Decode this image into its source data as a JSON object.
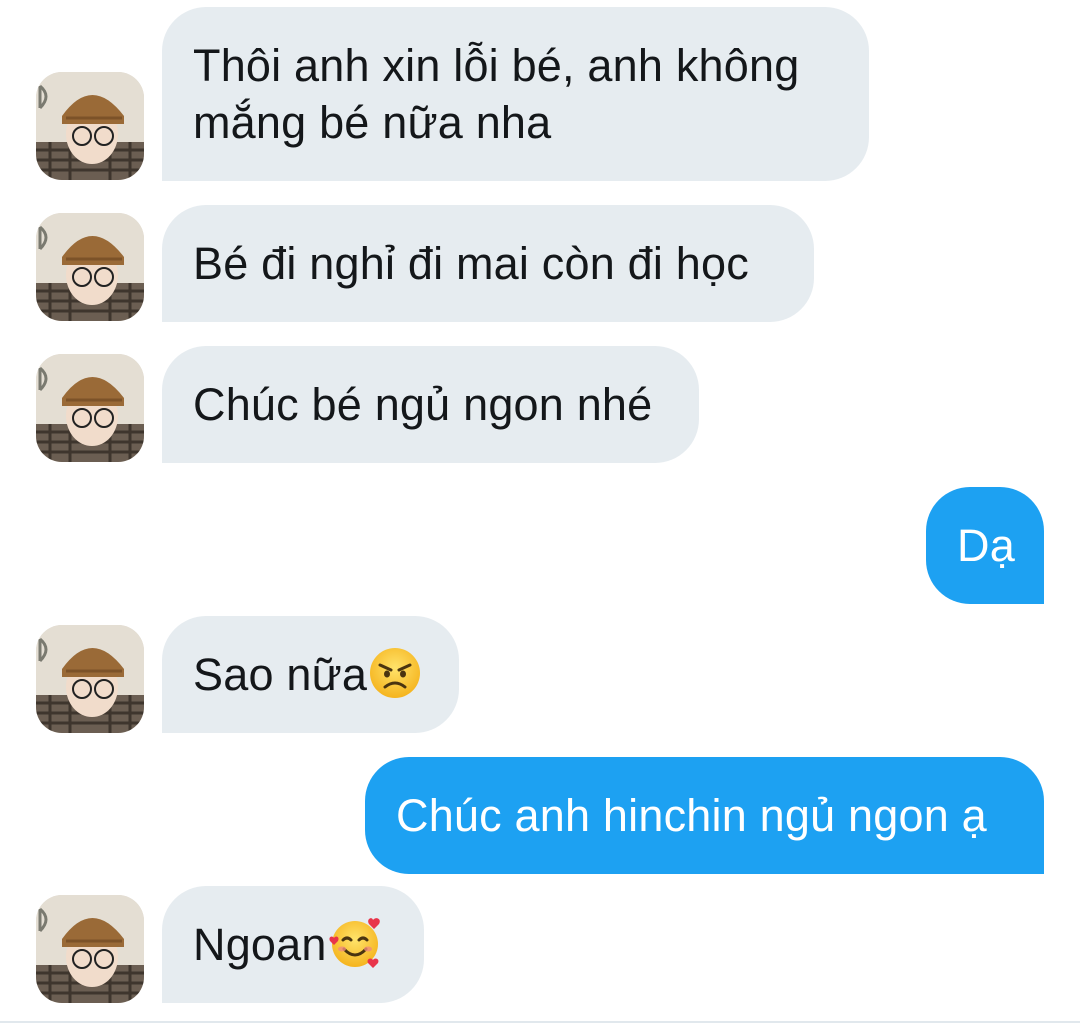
{
  "messages": [
    {
      "side": "in",
      "text": "Thôi anh xin lỗi bé, anh không\nmắng bé nữa nha"
    },
    {
      "side": "in",
      "text": "Bé đi nghỉ đi mai còn đi học"
    },
    {
      "side": "in",
      "text": "Chúc bé ngủ ngon nhé"
    },
    {
      "side": "out",
      "text": "Dạ"
    },
    {
      "side": "in",
      "text": "Sao nữa",
      "emoji": "angry-face-emoji"
    },
    {
      "side": "out",
      "text": "Chúc anh hinchin ngủ ngon ạ"
    },
    {
      "side": "in",
      "text": "Ngoan",
      "emoji": "smiling-face-with-hearts-emoji"
    }
  ],
  "colors": {
    "incoming_bubble": "#e6ecf0",
    "outgoing_bubble": "#1da1f2",
    "incoming_text": "#14171a",
    "outgoing_text": "#ffffff"
  }
}
